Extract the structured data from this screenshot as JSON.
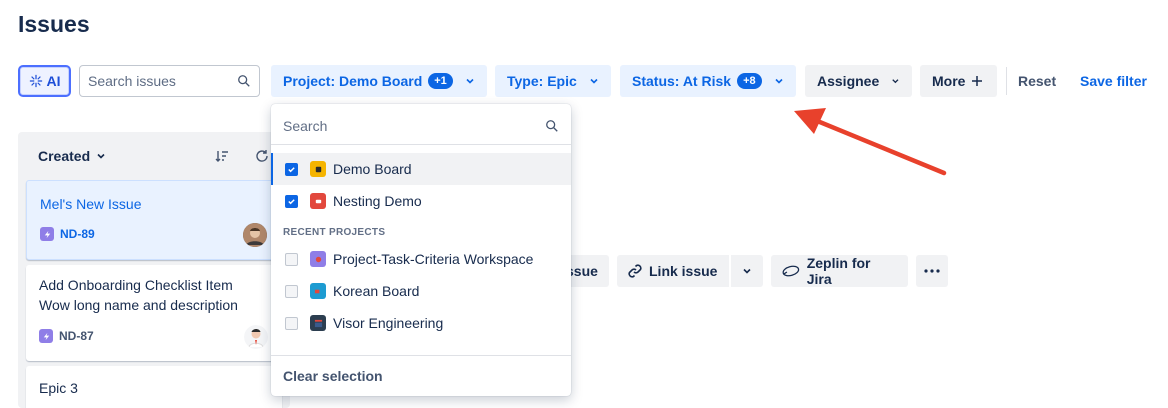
{
  "page": {
    "title": "Issues"
  },
  "toolbar": {
    "ai_label": "AI",
    "search_placeholder": "Search issues",
    "filters": [
      {
        "label": "Project: Demo Board",
        "badge": "+1"
      },
      {
        "label": "Type: Epic"
      },
      {
        "label": "Status: At Risk",
        "badge": "+8"
      },
      {
        "label": "Assignee"
      },
      {
        "label": "More"
      }
    ],
    "reset_label": "Reset",
    "save_filter_label": "Save filter"
  },
  "column": {
    "sort_label": "Created",
    "cards": [
      {
        "title": "Mel's New Issue",
        "key": "ND-89",
        "selected": true
      },
      {
        "title": "Add Onboarding Checklist Item Wow long name and description",
        "key": "ND-87"
      },
      {
        "title": "Epic 3"
      }
    ]
  },
  "detail_actions": {
    "issue_fragment": "ssue",
    "link_issue": "Link issue",
    "zeplin": "Zeplin for Jira"
  },
  "project_dropdown": {
    "search_placeholder": "Search",
    "selected_projects": [
      {
        "name": "Demo Board",
        "checked": true,
        "icon_color": "#f5b400"
      },
      {
        "name": "Nesting Demo",
        "checked": true,
        "icon_color": "#e2483d"
      }
    ],
    "recent_header": "RECENT PROJECTS",
    "recent_projects": [
      {
        "name": "Project-Task-Criteria Workspace",
        "checked": false,
        "icon_color": "#8f7ee7"
      },
      {
        "name": "Korean Board",
        "checked": false,
        "icon_color": "#1d9bd1"
      },
      {
        "name": "Visor Engineering",
        "checked": false,
        "icon_color": "#2c3e50"
      }
    ],
    "clear_label": "Clear selection"
  },
  "colors": {
    "accent": "#0c66e4",
    "arrow": "#e8412c"
  }
}
